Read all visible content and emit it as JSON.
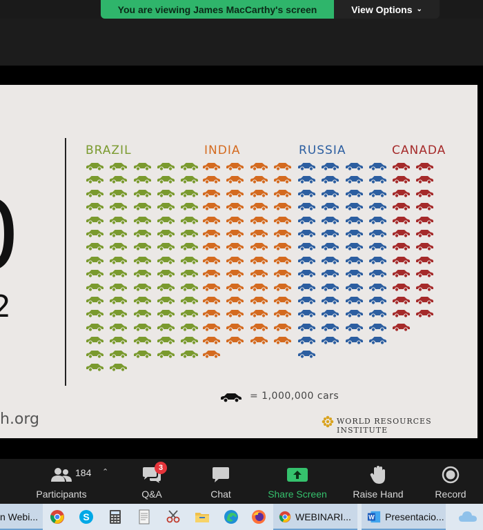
{
  "banner": {
    "viewing_text": "You are viewing James MacCarthy's screen",
    "view_options_label": "View Options",
    "chevron_icon": "chevron-down-icon"
  },
  "slide": {
    "big_number_fragment": "0",
    "small_number_fragment": "2",
    "site_fragment": "h.org",
    "legend_text": "= 1,000,000 cars",
    "organization": "WORLD RESOURCES INSTITUTE",
    "colors": {
      "brazil": "#7a9a2e",
      "india": "#d46a1f",
      "russia": "#2c5ea0",
      "canada": "#a52a2a",
      "background": "#ebe8e6"
    }
  },
  "chart_data": {
    "type": "pictogram",
    "unit_label": "= 1,000,000 cars",
    "categories": [
      "BRAZIL",
      "INDIA",
      "RUSSIA",
      "CANADA"
    ],
    "values": [
      77,
      57,
      57,
      25
    ]
  },
  "toolbar": {
    "participants_label": "Participants",
    "participants_count": "184",
    "qa_label": "Q&A",
    "qa_badge": "3",
    "chat_label": "Chat",
    "share_label": "Share Screen",
    "raise_hand_label": "Raise Hand",
    "record_label": "Record",
    "accent_green": "#35c16d"
  },
  "taskbar": {
    "left_window_label": "n Webi...",
    "webinar_label": "WEBINARI...",
    "word_label": "Presentacio..."
  }
}
